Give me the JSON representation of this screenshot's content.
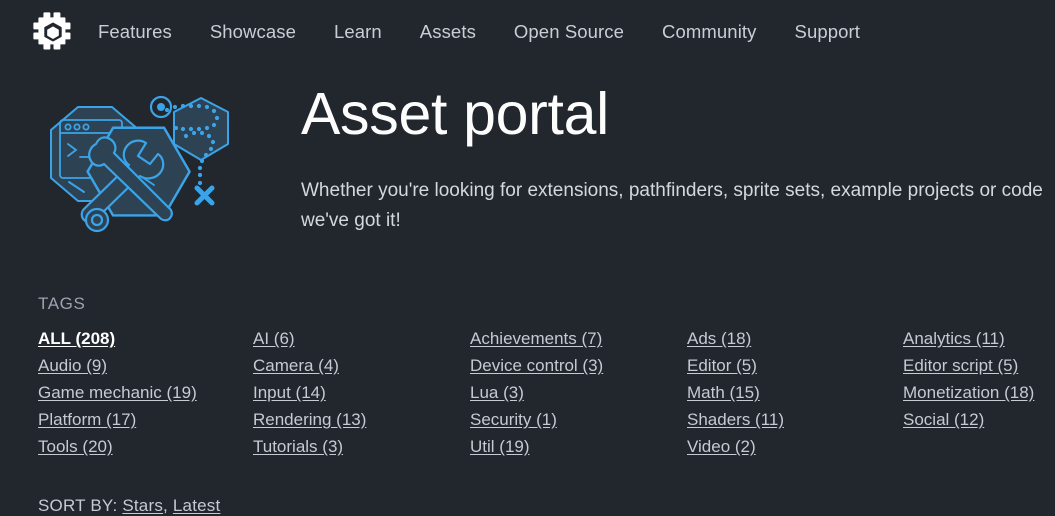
{
  "site": {
    "logo_name": "defold-logo-icon"
  },
  "nav": {
    "items": [
      {
        "label": "Features"
      },
      {
        "label": "Showcase"
      },
      {
        "label": "Learn"
      },
      {
        "label": "Assets"
      },
      {
        "label": "Open Source"
      },
      {
        "label": "Community"
      },
      {
        "label": "Support"
      }
    ]
  },
  "hero": {
    "illustration_name": "asset-tools-illustration",
    "title": "Asset portal",
    "description": "Whether you're looking for extensions, pathfinders, sprite sets, example projects or code\nwe've got it!"
  },
  "tags": {
    "label": "TAGS",
    "columns": [
      {
        "items": [
          {
            "label": "ALL (208)",
            "active": true
          },
          {
            "label": "Audio (9)",
            "active": false
          },
          {
            "label": "Game mechanic (19)",
            "active": false
          },
          {
            "label": "Platform (17)",
            "active": false
          },
          {
            "label": "Tools (20)",
            "active": false
          }
        ]
      },
      {
        "items": [
          {
            "label": "AI (6)",
            "active": false
          },
          {
            "label": "Camera (4)",
            "active": false
          },
          {
            "label": "Input (14)",
            "active": false
          },
          {
            "label": "Rendering (13)",
            "active": false
          },
          {
            "label": "Tutorials (3)",
            "active": false
          }
        ]
      },
      {
        "items": [
          {
            "label": "Achievements (7)",
            "active": false
          },
          {
            "label": "Device control (3)",
            "active": false
          },
          {
            "label": "Lua (3)",
            "active": false
          },
          {
            "label": "Security (1)",
            "active": false
          },
          {
            "label": "Util (19)",
            "active": false
          }
        ]
      },
      {
        "items": [
          {
            "label": "Ads (18)",
            "active": false
          },
          {
            "label": "Editor (5)",
            "active": false
          },
          {
            "label": "Math (15)",
            "active": false
          },
          {
            "label": "Shaders (11)",
            "active": false
          },
          {
            "label": "Video (2)",
            "active": false
          }
        ]
      },
      {
        "items": [
          {
            "label": "Analytics (11)",
            "active": false
          },
          {
            "label": "Editor script (5)",
            "active": false
          },
          {
            "label": "Monetization (18)",
            "active": false
          },
          {
            "label": "Social (12)",
            "active": false
          }
        ]
      }
    ]
  },
  "sort": {
    "label": "SORT BY:",
    "options": [
      {
        "label": "Stars"
      },
      {
        "label": "Latest"
      }
    ],
    "separator": ","
  },
  "colors": {
    "background": "#22262d",
    "text": "#c5cad3",
    "heading": "#fdfdfd",
    "accent_blue": "#3ba4e8",
    "illustration_fill": "#2d4353",
    "muted": "#9ba3ae"
  }
}
